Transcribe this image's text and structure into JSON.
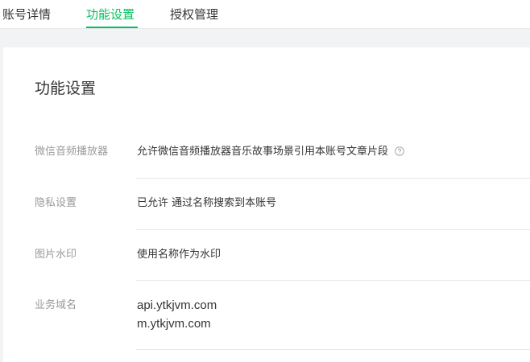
{
  "tabs": [
    {
      "label": "账号详情"
    },
    {
      "label": "功能设置"
    },
    {
      "label": "授权管理"
    }
  ],
  "active_tab_color": "#07c160",
  "panel": {
    "title": "功能设置",
    "rows": [
      {
        "label": "微信音频播放器",
        "value": "允许微信音频播放器音乐故事场景引用本账号文章片段",
        "icon": "help-circle-icon"
      },
      {
        "label": "隐私设置",
        "value": "已允许 通过名称搜索到本账号"
      },
      {
        "label": "图片水印",
        "value": "使用名称作为水印"
      },
      {
        "label": "业务域名",
        "values": [
          "api.ytkjvm.com",
          "m.ytkjvm.com"
        ]
      }
    ]
  }
}
